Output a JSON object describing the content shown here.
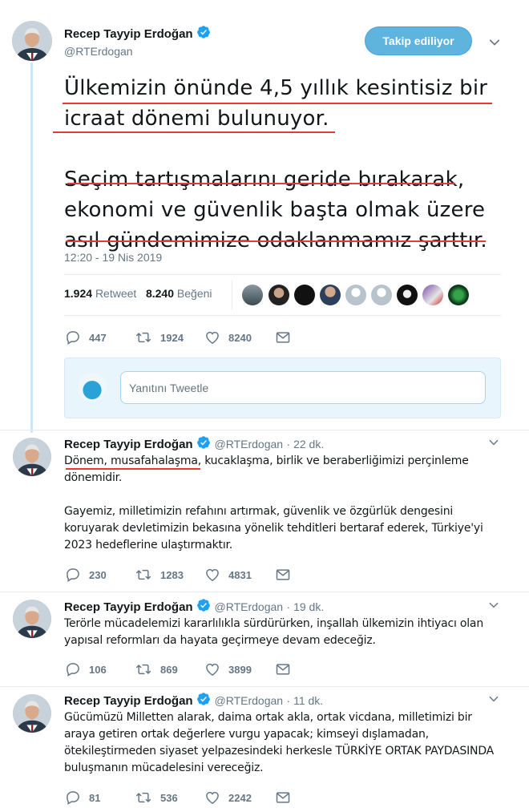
{
  "main_tweet": {
    "author": "Recep Tayyip Erdoğan",
    "handle": "@RTErdogan",
    "follow_label": "Takip ediliyor",
    "lines": [
      "Ülkemizin önünde 4,5 yıllık kesintisiz bir",
      "icraat dönemi bulunuyor.",
      "Seçim tartışmalarını geride bırakarak,",
      "ekonomi ve güvenlik başta olmak üzere",
      "asıl gündemimize odaklanmamız şarttır."
    ],
    "timestamp": "12:20 - 19 Nis 2019",
    "retweet_count": "1.924",
    "retweet_label": "Retweet",
    "like_count": "8.240",
    "like_label": "Beğeni",
    "actions": {
      "reply": "447",
      "retweet": "1924",
      "like": "8240"
    },
    "reply_placeholder": "Yanıtını Tweetle"
  },
  "thread": [
    {
      "author": "Recep Tayyip Erdoğan",
      "handle": "@RTErdogan",
      "time": "· 22 dk.",
      "paragraphs": [
        "Dönem, musafahalaşma, kucaklaşma, birlik ve beraberliğimizi perçinleme dönemidir.",
        "Gayemiz, milletimizin refahını artırmak, güvenlik ve özgürlük dengesini koruyarak devletimizin bekasına yönelik tehditleri bertaraf ederek, Türkiye'yi 2023 hedeflerine ulaştırmaktır."
      ],
      "actions": {
        "reply": "230",
        "retweet": "1283",
        "like": "4831"
      }
    },
    {
      "author": "Recep Tayyip Erdoğan",
      "handle": "@RTErdogan",
      "time": "· 19 dk.",
      "paragraphs": [
        "Terörle mücadelemizi kararlılıkla sürdürürken, inşallah ülkemizin ihtiyacı olan yapısal reformları da hayata geçirmeye devam edeceğiz."
      ],
      "actions": {
        "reply": "106",
        "retweet": "869",
        "like": "3899"
      }
    },
    {
      "author": "Recep Tayyip Erdoğan",
      "handle": "@RTErdogan",
      "time": "· 11 dk.",
      "paragraphs": [
        "Gücümüzü Milletten alarak, daima ortak akla, ortak vicdana, milletimizi bir araya getiren ortak değerlere vurgu yapacak; kimseyi dışlamadan, ötekileştirmeden siyaset yelpazesindeki herkesle  TÜRKİYE ORTAK PAYDASINDA buluşmanın mücadelesini vereceğiz."
      ],
      "actions": {
        "reply": "81",
        "retweet": "536",
        "like": "2242"
      }
    }
  ],
  "icons": {
    "verified": "verified-badge-icon",
    "caret": "chevron-down-icon",
    "reply": "reply-icon",
    "retweet": "retweet-icon",
    "like": "heart-icon",
    "dm": "envelope-icon"
  },
  "colors": {
    "accent": "#1da1f2",
    "follow_button": "#5fb4de",
    "thread_line": "#c8e6fa",
    "underline_annotation": "#e23a3a",
    "muted_text": "#657786"
  }
}
